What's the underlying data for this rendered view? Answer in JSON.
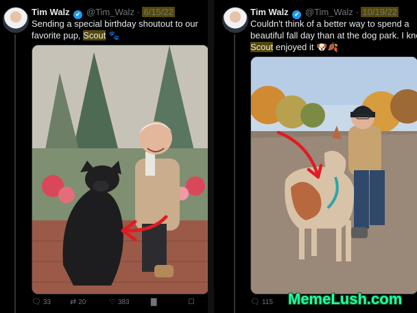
{
  "left_tweet": {
    "author_name": "Tim Walz",
    "verified_mark": "✔",
    "handle": "@Tim_Walz",
    "separator": "·",
    "date": "6/15/22",
    "text_before": "Sending a special birthday shoutout to our favorite pup, ",
    "highlight": "Scout",
    "text_after": " 🐾",
    "metrics": {
      "replies": "33",
      "retweets": "20",
      "likes": "383",
      "views": ""
    },
    "icons": [
      "reply-icon",
      "retweet-icon",
      "like-icon",
      "views-icon",
      "bookmark-icon"
    ]
  },
  "right_tweet": {
    "author_name": "Tim Walz",
    "verified_mark": "✔",
    "handle": "@Tim_Walz",
    "separator": "·",
    "date": "10/19/22",
    "text_line1": "Couldn't think of a better way to spend a",
    "text_line2": "beautiful fall day than at the dog park. I know",
    "highlight": "Scout",
    "text_after": " enjoyed it 🐶🍂",
    "metrics": {
      "replies": "115"
    },
    "icons": [
      "reply-icon"
    ]
  },
  "watermark": "MemeLush.com",
  "colors": {
    "background": "#000000",
    "text": "#e7e9ea",
    "muted": "#71767b",
    "verified": "#1d9bf0",
    "highlight": "#f0d214",
    "arrow": "#e01b24",
    "watermark": "#22ff9e"
  }
}
